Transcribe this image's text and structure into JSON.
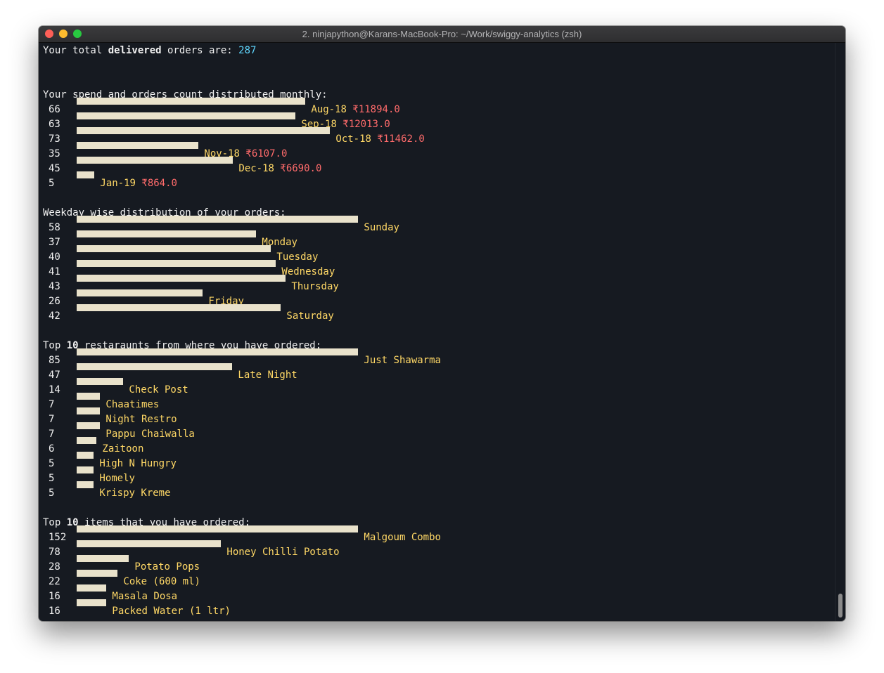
{
  "window": {
    "title": "2. ninjapython@Karans-MacBook-Pro: ~/Work/swiggy-analytics (zsh)"
  },
  "summary": {
    "prefix": "Your total ",
    "bold": "delivered",
    "suffix": " orders are: ",
    "count": "287"
  },
  "chart_data": [
    {
      "type": "bar",
      "title": "Your spend and orders count distributed monthly:",
      "categories": [
        "Aug-18",
        "Sep-18",
        "Oct-18",
        "Nov-18",
        "Dec-18",
        "Jan-19"
      ],
      "values": [
        66,
        63,
        73,
        35,
        45,
        5
      ],
      "spend": [
        "₹11894.0",
        "₹12013.0",
        "₹11462.0",
        "₹6107.0",
        "₹6690.0",
        "₹864.0"
      ],
      "max": 73
    },
    {
      "type": "bar",
      "title": "Weekday wise distribution of your orders:",
      "categories": [
        "Sunday",
        "Monday",
        "Tuesday",
        "Wednesday",
        "Thursday",
        "Friday",
        "Saturday"
      ],
      "values": [
        58,
        37,
        40,
        41,
        43,
        26,
        42
      ],
      "max": 58
    },
    {
      "type": "bar",
      "title_parts": [
        "Top ",
        "10",
        " restaraunts from where you have ordered:"
      ],
      "categories": [
        "Just Shawarma",
        "Late Night",
        "Check Post",
        "Chaatimes",
        "Night Restro",
        "Pappu Chaiwalla",
        "Zaitoon",
        "High N Hungry",
        "Homely",
        "Krispy Kreme"
      ],
      "values": [
        85,
        47,
        14,
        7,
        7,
        7,
        6,
        5,
        5,
        5
      ],
      "max": 85
    },
    {
      "type": "bar",
      "title_parts": [
        "Top ",
        "10",
        " items that you have ordered:"
      ],
      "categories": [
        "Malgoum Combo",
        "Honey Chilli Potato",
        "Potato Pops",
        "Coke (600 ml)",
        "Masala Dosa",
        "Packed Water (1 ltr)"
      ],
      "values": [
        152,
        78,
        28,
        22,
        16,
        16
      ],
      "max": 152
    }
  ],
  "colors": {
    "background": "#161a21",
    "bar": "#e9e2cb",
    "label": "#ffd866",
    "spend": "#ff6b6b",
    "count": "#5fd7ff"
  }
}
